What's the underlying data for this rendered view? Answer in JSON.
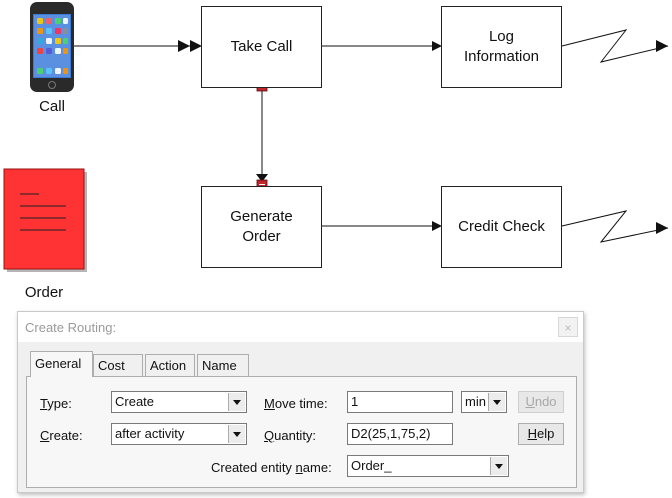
{
  "diagram": {
    "nodes": {
      "take_call": "Take Call",
      "log_information": "Log\nInformation",
      "generate_order": "Generate\nOrder",
      "credit_check": "Credit Check"
    },
    "entities": {
      "call_caption": "Call",
      "order_caption": "Order"
    }
  },
  "dialog": {
    "title": "Create Routing:",
    "close_glyph": "×",
    "tabs": [
      "General",
      "Cost",
      "Action",
      "Name"
    ],
    "active_tab": "General",
    "type_label": "Type:",
    "type_value": "Create",
    "create_label": "Create:",
    "create_value": "after activity",
    "move_time_label": "Move time:",
    "move_time_value": "1",
    "move_time_unit": "min",
    "quantity_label": "Quantity:",
    "quantity_value": "D2(25,1,75,2)",
    "entity_name_label": "Created entity name:",
    "entity_name_value": "Order_",
    "undo_label": "Undo",
    "help_label": "Help"
  },
  "colors": {
    "order_icon_fill": "#ff3333",
    "phone_body": "#2a2a2a",
    "connector_marker": "#c0262c"
  }
}
